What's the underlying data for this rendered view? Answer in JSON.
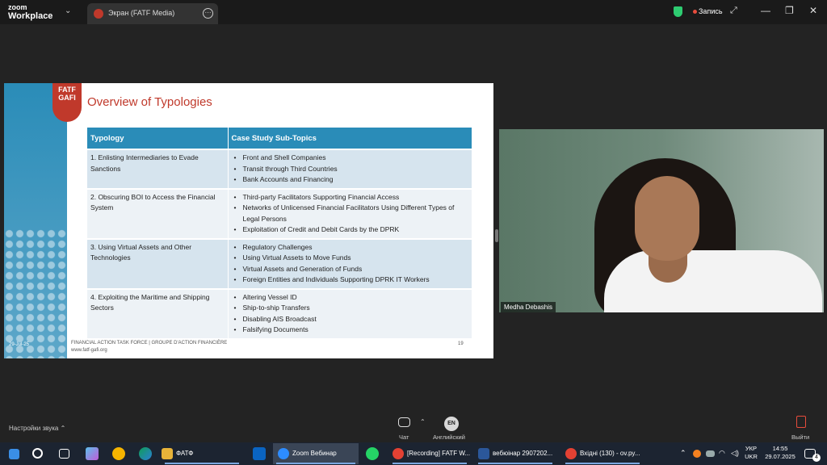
{
  "window": {
    "app_name_line1": "zoom",
    "app_name_line2": "Workplace",
    "tab_title": "Экран (FATF Media)",
    "recording_label": "Запись",
    "colors": {
      "recording": "#e74c3c",
      "security": "#2ecc71"
    }
  },
  "slide": {
    "logo_line1": "FATF",
    "logo_line2": "GAFI",
    "title": "Overview of Typologies",
    "table": {
      "headers": [
        "Typology",
        "Case Study Sub-Topics"
      ],
      "rows": [
        {
          "typology": "1. Enlisting Intermediaries to Evade Sanctions",
          "subtopics": [
            "Front and Shell Companies",
            "Transit through Third Countries",
            "Bank Accounts and Financing"
          ]
        },
        {
          "typology": "2. Obscuring BOI to Access the Financial System",
          "subtopics": [
            "Third-party Facilitators Supporting Financial Access",
            "Networks of Unlicensed Financial Facilitators Using Different Types of Legal Persons",
            "Exploitation of Credit and Debit Cards by the DPRK"
          ]
        },
        {
          "typology": "3. Using Virtual Assets and Other Technologies",
          "subtopics": [
            "Regulatory Challenges",
            "Using Virtual Assets to Move Funds",
            "Virtual Assets and Generation of Funds",
            "Foreign Entities and Individuals Supporting DPRK IT Workers"
          ]
        },
        {
          "typology": "4. Exploiting the Maritime and Shipping Sectors",
          "subtopics": [
            "Altering Vessel ID",
            "Ship-to-ship Transfers",
            "Disabling AIS Broadcast",
            "Falsifying Documents"
          ]
        }
      ]
    },
    "date": "29-Jul-25",
    "footer_line1": "FINANCIAL ACTION TASK FORCE | GROUPE D'ACTION FINANCIÈRE",
    "footer_line2": "www.fatf-gafi.org",
    "page_number": "19"
  },
  "participant": {
    "name": "Medha Debashis"
  },
  "controls": {
    "audio_settings": "Настройки звука",
    "chat": "Чат",
    "language_badge": "EN",
    "language": "Английский",
    "exit": "Выйти"
  },
  "taskbar": {
    "apps": [
      {
        "label": "ФАТФ",
        "color": "#e8b339"
      },
      {
        "label": "Zoom Вебинар",
        "color": "#2d8cff"
      },
      {
        "label": "[Recording] FATF W...",
        "color": "#e34133"
      },
      {
        "label": "вебюінар 2907202...",
        "color": "#2b579a"
      },
      {
        "label": "Вхідні (130) - ov.py...",
        "color": "#e34133"
      }
    ],
    "lang_line1": "УКР",
    "lang_line2": "UKR",
    "time": "14:55",
    "date": "29.07.2025",
    "notifications": "4"
  }
}
